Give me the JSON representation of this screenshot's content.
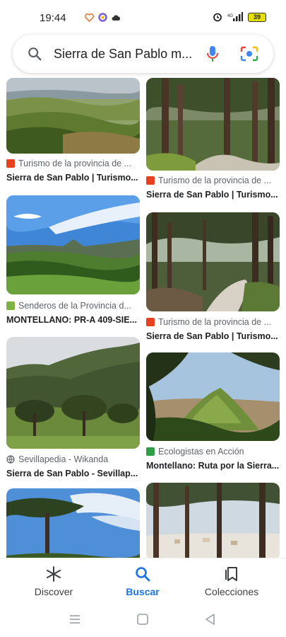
{
  "status_bar": {
    "time": "19:44",
    "battery": "39"
  },
  "search": {
    "query": "Sierra de San Pablo m..."
  },
  "results": [
    {
      "source": "Turismo de la provincia de ...",
      "title": "Sierra de San Pablo | Turismo...",
      "favicon_color": "#e8411f"
    },
    {
      "source": "Turismo de la provincia de ...",
      "title": "Sierra de San Pablo | Turismo...",
      "favicon_color": "#e8411f"
    },
    {
      "source": "Senderos de la Provincia d...",
      "title": "MONTELLANO: PR-A 409-SIE...",
      "favicon_color": "#7cb342"
    },
    {
      "source": "Turismo de la provincia de ...",
      "title": "Sierra de San Pablo | Turismo...",
      "favicon_color": "#e8411f"
    },
    {
      "source": "Sevillapedia - Wikanda",
      "title": "Sierra de San Pablo - Sevillap...",
      "favicon_color": "#5f6368"
    },
    {
      "source": "Ecologistas en Acción",
      "title": "Montellano: Ruta por la Sierra...",
      "favicon_color": "#2e9e47"
    }
  ],
  "bottom_nav": {
    "discover": "Discover",
    "search": "Buscar",
    "collections": "Colecciones",
    "active": "Buscar",
    "active_color": "#1a73e8"
  }
}
